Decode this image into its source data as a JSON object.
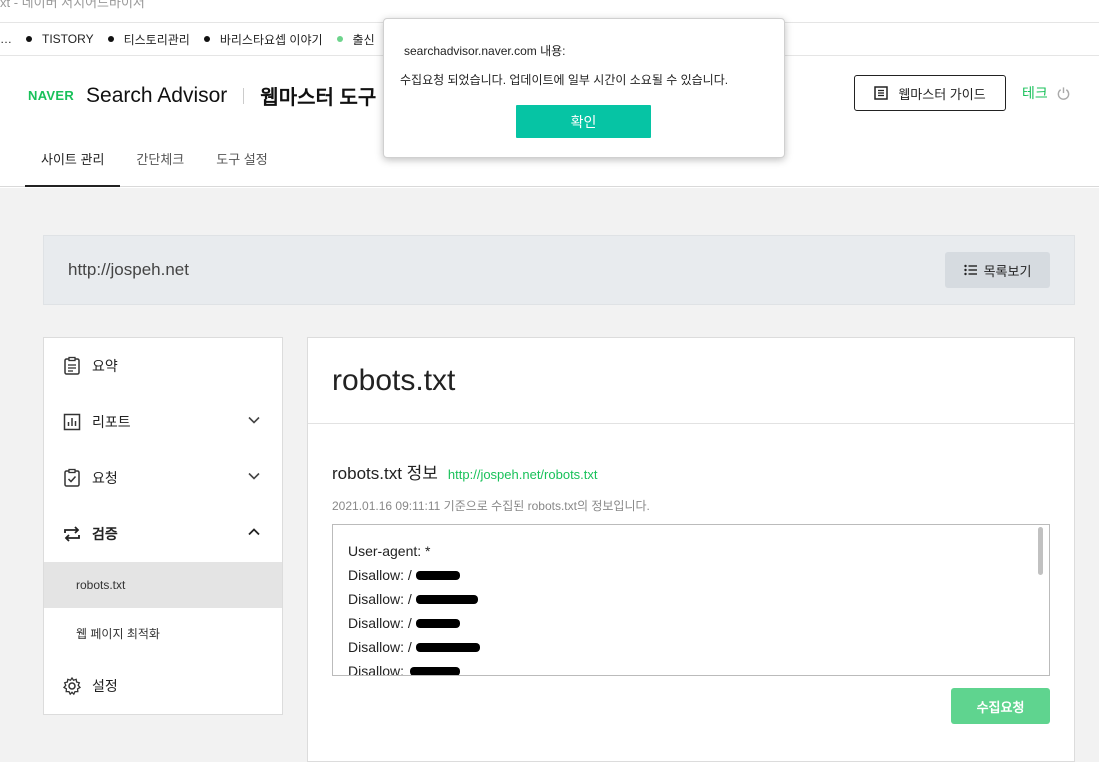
{
  "browser": {
    "title": "xt - 네이버 서치어드바이저",
    "bookmarks": [
      "TISTORY",
      "티스토리관리",
      "바리스타요셉 이야기",
      "출신"
    ]
  },
  "header": {
    "brand": "NAVER",
    "product": "Search Advisor",
    "tool": "웹마스터 도구",
    "guide_label": "웹마스터 가이드",
    "user_name": "테크",
    "tabs": [
      "사이트 관리",
      "간단체크",
      "도구 설정"
    ]
  },
  "site": {
    "url": "http://jospeh.net",
    "list_label": "목록보기"
  },
  "sidebar": {
    "items": [
      {
        "label": "요약",
        "icon": "clipboard-list-icon"
      },
      {
        "label": "리포트",
        "icon": "chart-icon"
      },
      {
        "label": "요청",
        "icon": "clipboard-check-icon"
      },
      {
        "label": "검증",
        "icon": "swap-arrows-icon"
      },
      {
        "label": "설정",
        "icon": "gear-icon"
      }
    ],
    "subitems": [
      "robots.txt",
      "웹 페이지 최적화"
    ]
  },
  "panel": {
    "title": "robots.txt",
    "info_title": "robots.txt 정보",
    "info_link": "http://jospeh.net/robots.txt",
    "info_desc": "2021.01.16 09:11:11 기준으로 수집된 robots.txt의 정보입니다.",
    "robots_lines": [
      "User-agent: *",
      "Disallow: /",
      "Disallow: /",
      "Disallow: /",
      "Disallow: /",
      "Disallow: "
    ],
    "collect_label": "수집요청"
  },
  "dialog": {
    "title": "searchadvisor.naver.com 내용:",
    "message": "수집요청 되었습니다. 업데이트에 일부 시간이 소요될 수 있습니다.",
    "ok_label": "확인"
  },
  "colors": {
    "naver_green": "#19c15a",
    "dialog_button": "#06c4a4",
    "collect_button": "#5fd48f"
  }
}
